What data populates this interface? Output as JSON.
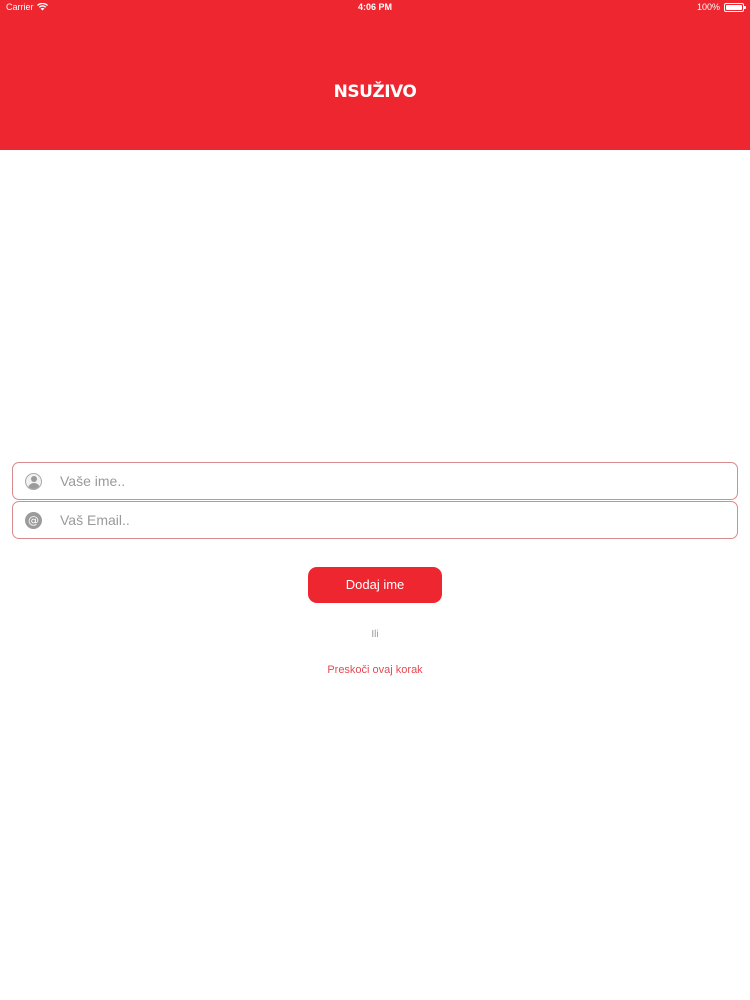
{
  "status_bar": {
    "carrier": "Carrier",
    "time": "4:06 PM",
    "battery_percent": "100%",
    "battery_level": 1.0
  },
  "header": {
    "logo_text": "NSUŽIVO",
    "background_color": "#ed2630"
  },
  "form": {
    "name_field": {
      "placeholder": "Vaše ime..",
      "value": "",
      "icon": "person-icon"
    },
    "email_field": {
      "placeholder": "Vaš Email..",
      "value": "",
      "icon": "at-icon"
    },
    "submit_label": "Dodaj ime",
    "or_label": "Ili",
    "skip_label": "Preskoči ovaj korak"
  },
  "colors": {
    "accent": "#ed2630",
    "field_border": "#d98a8d",
    "link": "#e54a52",
    "muted_text": "#9a9a9a"
  }
}
